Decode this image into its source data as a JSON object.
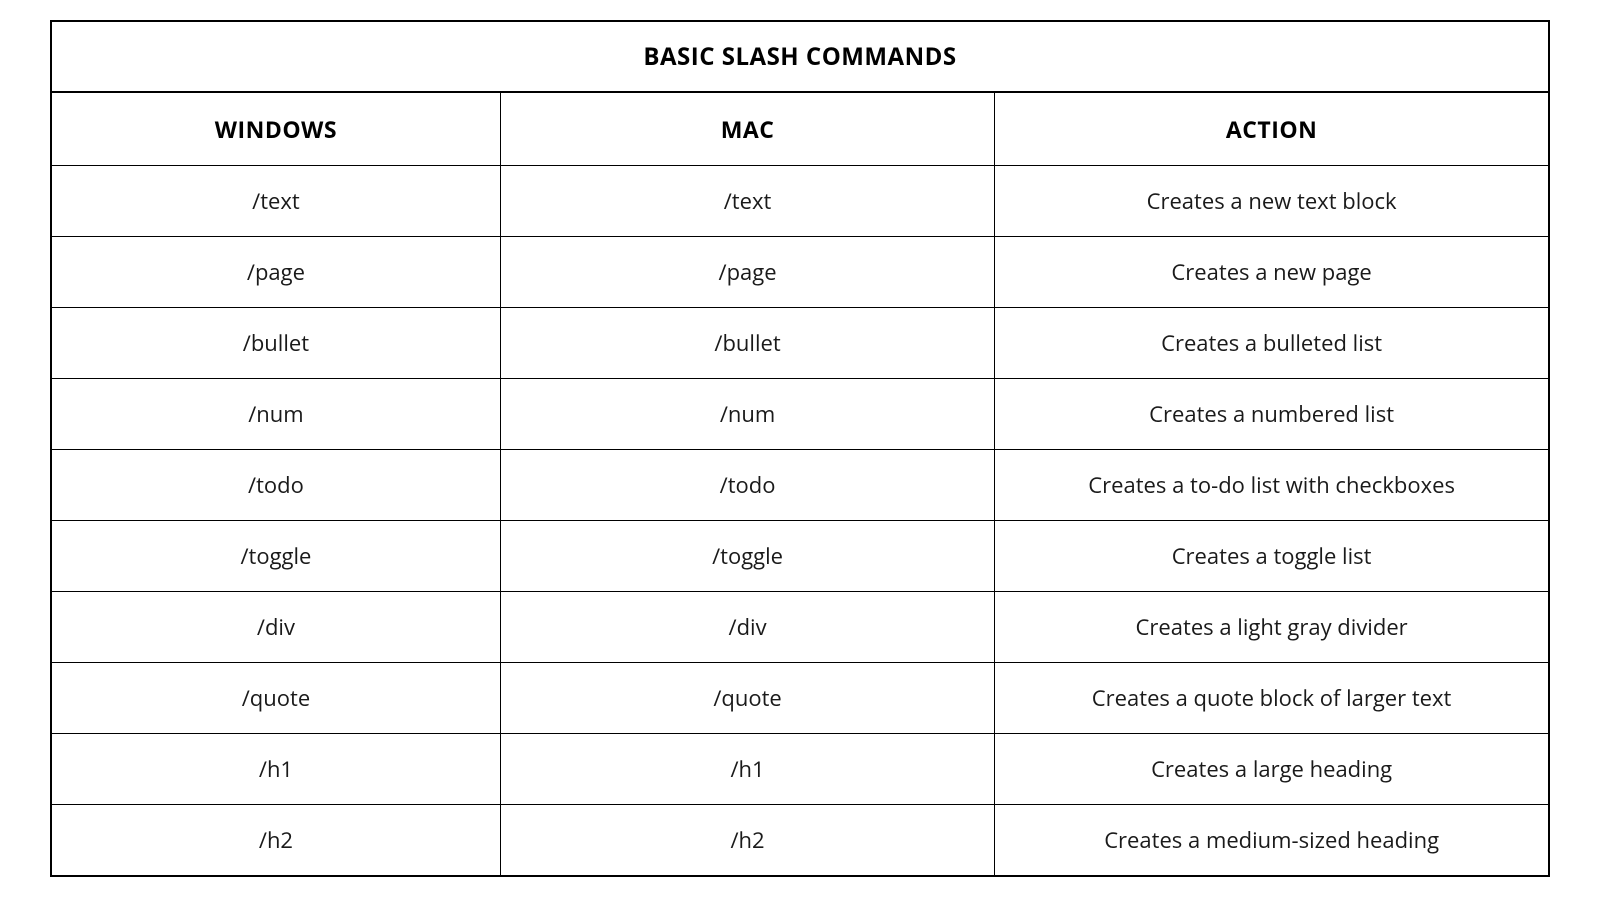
{
  "table": {
    "title": "BASIC SLASH COMMANDS",
    "columns": [
      "WINDOWS",
      "MAC",
      "ACTION"
    ],
    "rows": [
      {
        "windows": "/text",
        "mac": "/text",
        "action": "Creates a new text block"
      },
      {
        "windows": "/page",
        "mac": "/page",
        "action": "Creates a new page"
      },
      {
        "windows": "/bullet",
        "mac": "/bullet",
        "action": "Creates a bulleted list"
      },
      {
        "windows": "/num",
        "mac": "/num",
        "action": "Creates a numbered list"
      },
      {
        "windows": "/todo",
        "mac": "/todo",
        "action": "Creates a to-do list with checkboxes"
      },
      {
        "windows": "/toggle",
        "mac": "/toggle",
        "action": "Creates a toggle list"
      },
      {
        "windows": "/div",
        "mac": "/div",
        "action": "Creates a light gray divider"
      },
      {
        "windows": "/quote",
        "mac": "/quote",
        "action": "Creates a quote block of larger text"
      },
      {
        "windows": "/h1",
        "mac": "/h1",
        "action": "Creates a large heading"
      },
      {
        "windows": "/h2",
        "mac": "/h2",
        "action": "Creates a medium-sized heading"
      }
    ]
  }
}
